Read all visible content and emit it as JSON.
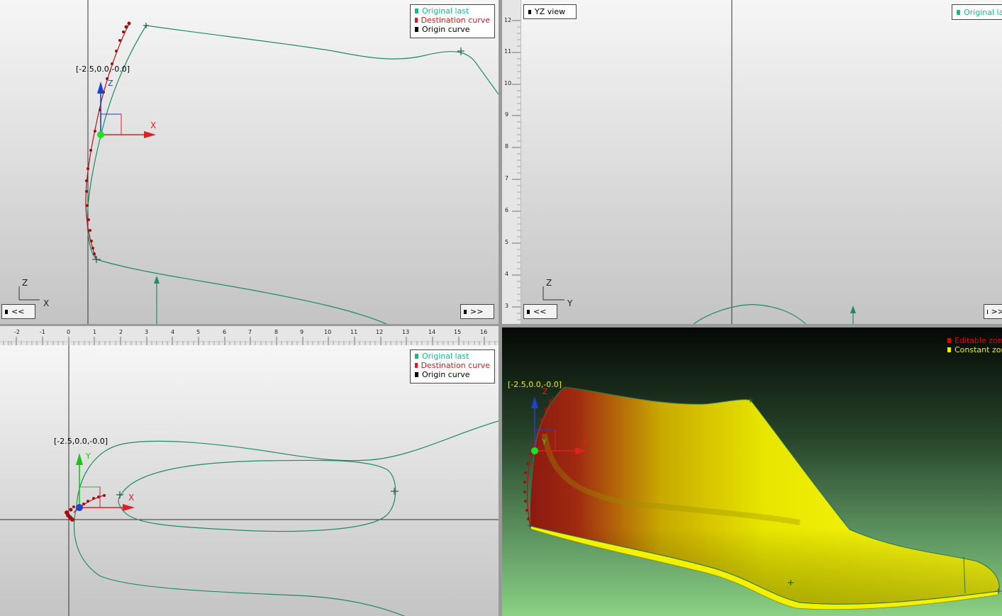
{
  "legend": {
    "original_last": "Original last",
    "destination_curve": "Destination curve",
    "origin_curve": "Origin curve"
  },
  "legend_yz": {
    "original_last": "Original la"
  },
  "legend_3d": {
    "editable": "Editable zon",
    "constant": "Constant zon"
  },
  "xz_view": {
    "coord_label": "[-2.5,0.0,-0.0]",
    "axis_z": "Z",
    "axis_x": "X",
    "prev_button": "<<",
    "next_button": ">>"
  },
  "yz_view": {
    "view_label": "YZ view",
    "axis_z": "Z",
    "axis_y": "Y",
    "prev_button": "<<",
    "next_button": ">>",
    "ruler_ticks": [
      "12",
      "11",
      "10",
      "9",
      "8",
      "7",
      "6",
      "5",
      "4",
      "3"
    ]
  },
  "xy_view": {
    "coord_label": "[-2.5,0.0,-0.0]",
    "axis_y": "Y",
    "axis_x": "X"
  },
  "view_3d": {
    "coord_label": "[-2.5,0.0,-0.0]",
    "axis_z": "Z",
    "axis_y": "Y",
    "axis_x": "X"
  },
  "ruler": {
    "ticks": [
      "-2",
      "-1",
      "0",
      "1",
      "2",
      "3",
      "4",
      "5",
      "6",
      "7",
      "8",
      "9",
      "10",
      "11",
      "12",
      "13",
      "14",
      "15",
      "16"
    ]
  },
  "colors": {
    "curve": "#1f8a68",
    "destination": "#b31212",
    "legend_green": "#16b98a",
    "legend_red": "#e01818",
    "editable": "#e00000",
    "constant": "#f0f000"
  }
}
